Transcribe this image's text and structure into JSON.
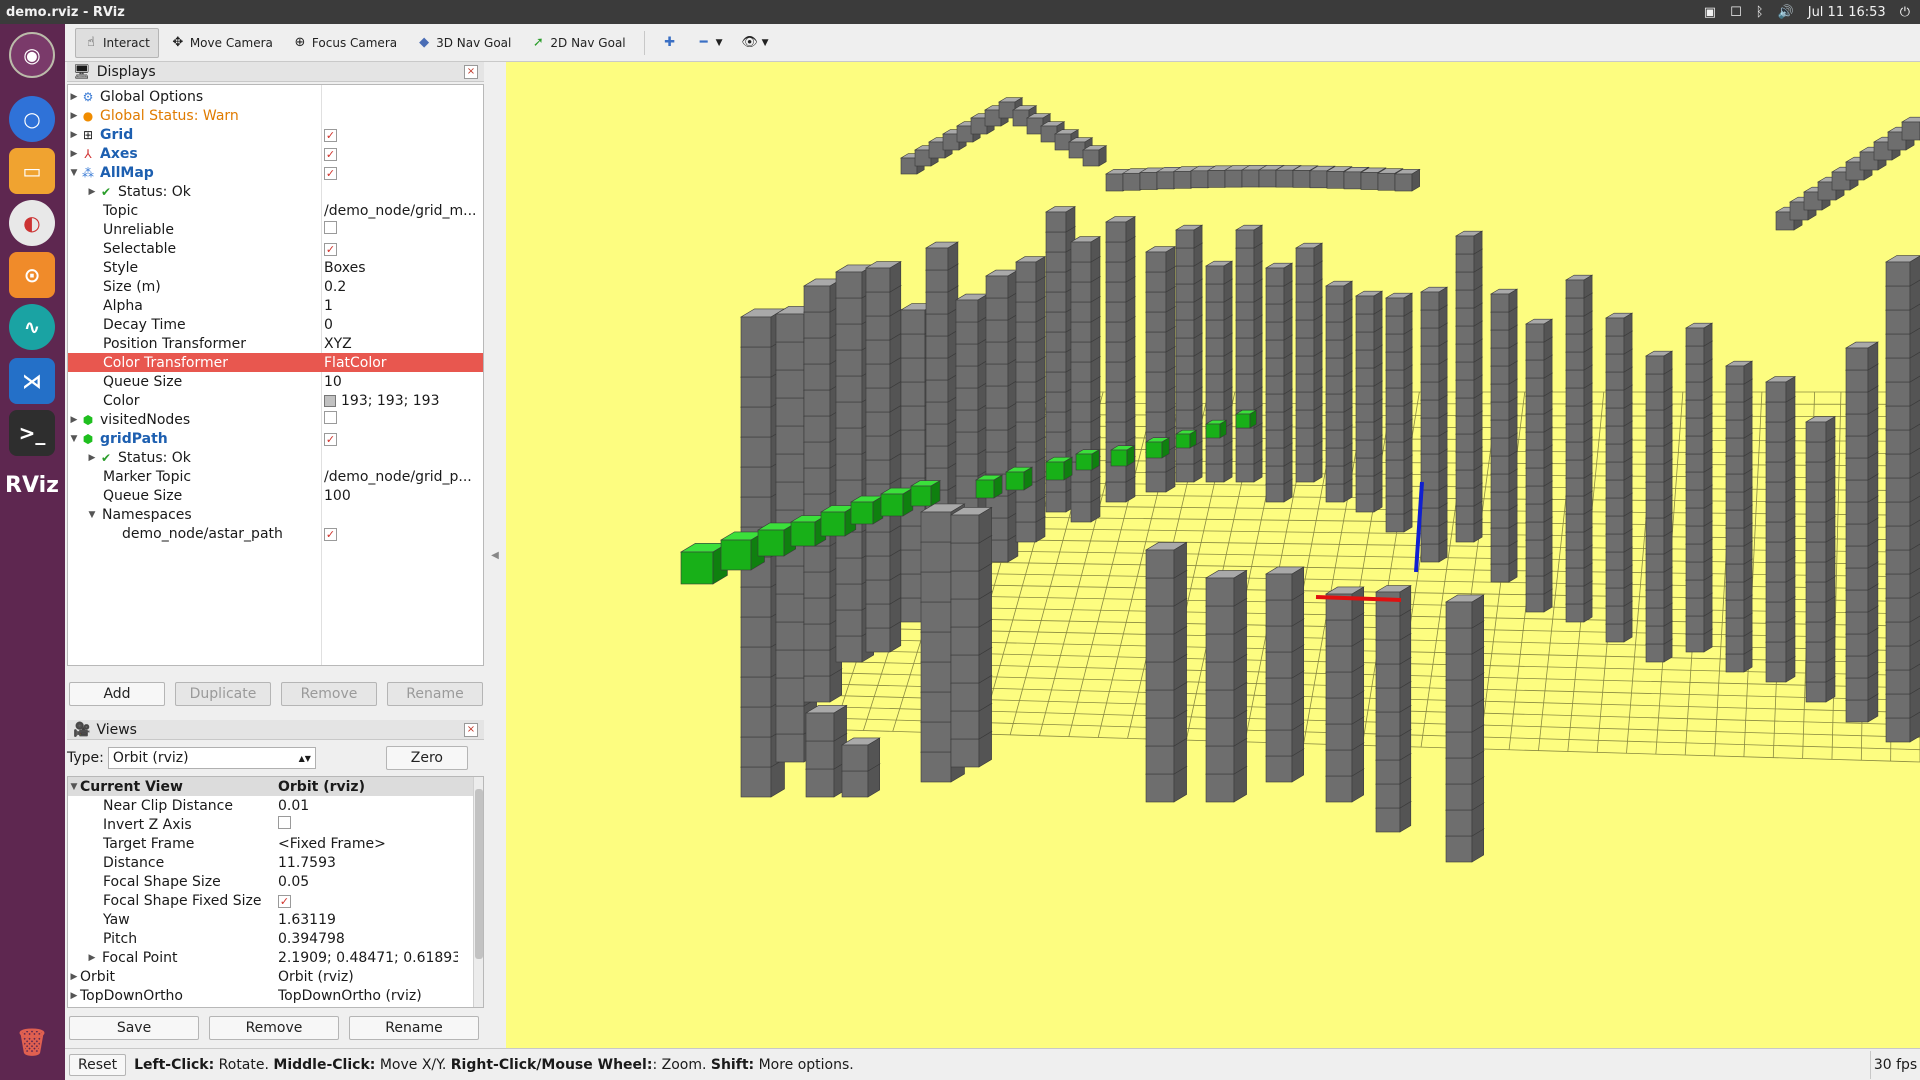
{
  "window": {
    "title": "demo.rviz - RViz"
  },
  "tray": {
    "datetime": "Jul 11 16:53"
  },
  "toolbar": {
    "interact": "Interact",
    "move_camera": "Move Camera",
    "focus_camera": "Focus Camera",
    "nav_goal_3d": "3D Nav Goal",
    "nav_goal_2d": "2D Nav Goal"
  },
  "displays": {
    "title": "Displays",
    "rows": [
      {
        "name": "Global Options",
        "value": ""
      },
      {
        "name": "Global Status: Warn",
        "value": ""
      },
      {
        "name": "Grid",
        "value": ""
      },
      {
        "name": "Axes",
        "value": ""
      },
      {
        "name": "AllMap",
        "value": ""
      },
      {
        "name": "Status: Ok",
        "value": ""
      },
      {
        "name": "Topic",
        "value": "/demo_node/grid_m..."
      },
      {
        "name": "Unreliable",
        "value": ""
      },
      {
        "name": "Selectable",
        "value": ""
      },
      {
        "name": "Style",
        "value": "Boxes"
      },
      {
        "name": "Size (m)",
        "value": "0.2"
      },
      {
        "name": "Alpha",
        "value": "1"
      },
      {
        "name": "Decay Time",
        "value": "0"
      },
      {
        "name": "Position Transformer",
        "value": "XYZ"
      },
      {
        "name": "Color Transformer",
        "value": "FlatColor"
      },
      {
        "name": "Queue Size",
        "value": "10"
      },
      {
        "name": "Color",
        "value": "193; 193; 193"
      },
      {
        "name": "visitedNodes",
        "value": ""
      },
      {
        "name": "gridPath",
        "value": ""
      },
      {
        "name": "Status: Ok",
        "value": ""
      },
      {
        "name": "Marker Topic",
        "value": "/demo_node/grid_p..."
      },
      {
        "name": "Queue Size",
        "value": "100"
      },
      {
        "name": "Namespaces",
        "value": ""
      },
      {
        "name": "demo_node/astar_path",
        "value": ""
      }
    ],
    "buttons": {
      "add": "Add",
      "duplicate": "Duplicate",
      "remove": "Remove",
      "rename": "Rename"
    }
  },
  "views": {
    "title": "Views",
    "type_label": "Type:",
    "type_value": "Orbit (rviz)",
    "zero": "Zero",
    "rows": [
      {
        "name": "Current View",
        "value": "Orbit (rviz)"
      },
      {
        "name": "Near Clip Distance",
        "value": "0.01"
      },
      {
        "name": "Invert Z Axis",
        "value": ""
      },
      {
        "name": "Target Frame",
        "value": "<Fixed Frame>"
      },
      {
        "name": "Distance",
        "value": "11.7593"
      },
      {
        "name": "Focal Shape Size",
        "value": "0.05"
      },
      {
        "name": "Focal Shape Fixed Size",
        "value": ""
      },
      {
        "name": "Yaw",
        "value": "1.63119"
      },
      {
        "name": "Pitch",
        "value": "0.394798"
      },
      {
        "name": "Focal Point",
        "value": "2.1909; 0.48471; 0.61893"
      },
      {
        "name": "Orbit",
        "value": "Orbit (rviz)"
      },
      {
        "name": "TopDownOrtho",
        "value": "TopDownOrtho (rviz)"
      }
    ],
    "buttons": {
      "save": "Save",
      "remove": "Remove",
      "rename": "Rename"
    }
  },
  "status": {
    "reset": "Reset",
    "left_click": "Left-Click:",
    "left_click_desc": "Rotate.",
    "middle_click": "Middle-Click:",
    "middle_click_desc": "Move X/Y.",
    "right_click": "Right-Click/Mouse Wheel:",
    "right_click_desc": ": Zoom.",
    "shift": "Shift:",
    "shift_desc": "More options.",
    "fps": "30 fps"
  },
  "colors": {
    "background": "#fdfd80",
    "boxes": "#6e6e6e",
    "path": "#1fbf1f",
    "selection": "#e8574f",
    "launcher": "#5e2750"
  }
}
